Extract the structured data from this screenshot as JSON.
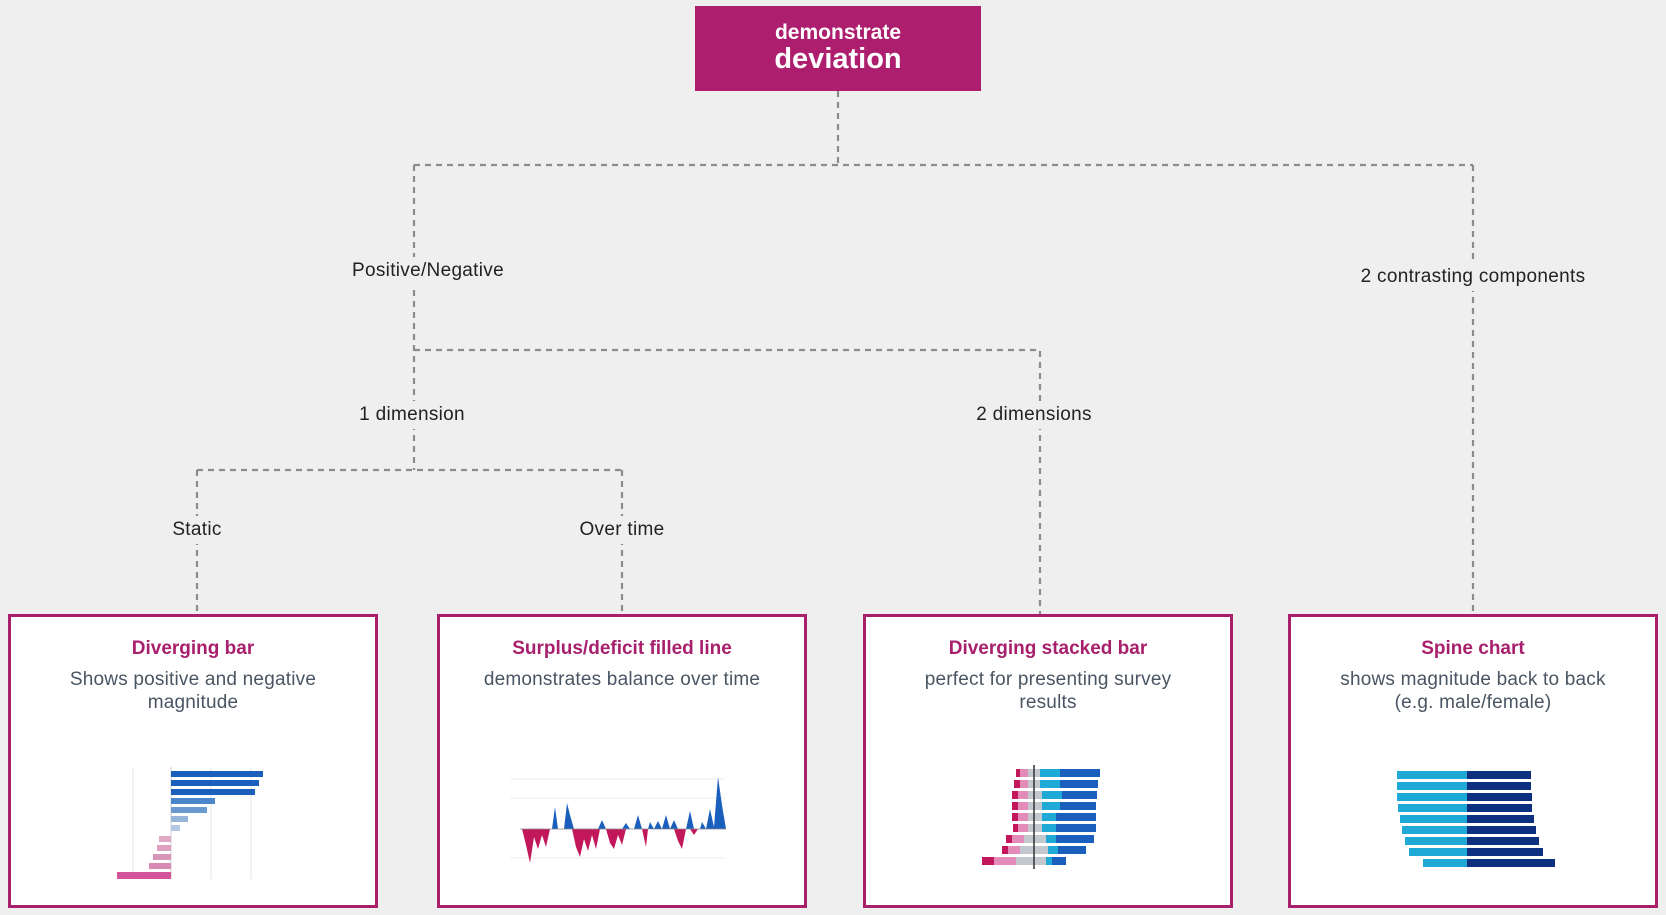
{
  "root": {
    "line1": "demonstrate",
    "line2": "deviation"
  },
  "branches": {
    "positive_negative": "Positive/Negative",
    "contrasting": "2 contrasting components",
    "one_dimension": "1 dimension",
    "two_dimensions": "2 dimensions",
    "static": "Static",
    "over_time": "Over time"
  },
  "cards": [
    {
      "title": "Diverging bar",
      "desc": "Shows positive and negative magnitude"
    },
    {
      "title": "Surplus/deficit filled line",
      "desc": "demonstrates balance over time"
    },
    {
      "title": "Diverging stacked bar",
      "desc": "perfect for presenting survey results"
    },
    {
      "title": "Spine chart",
      "desc": "shows magnitude back to back (e.g. male/female)"
    }
  ],
  "colors": {
    "accent": "#ad1f6e",
    "background": "#efefef",
    "connector": "#8c8c8c",
    "blue_dark": "#0d3a8c",
    "blue": "#1b5fbd",
    "blue_light": "#1fa9d6",
    "pink": "#c2185b"
  }
}
